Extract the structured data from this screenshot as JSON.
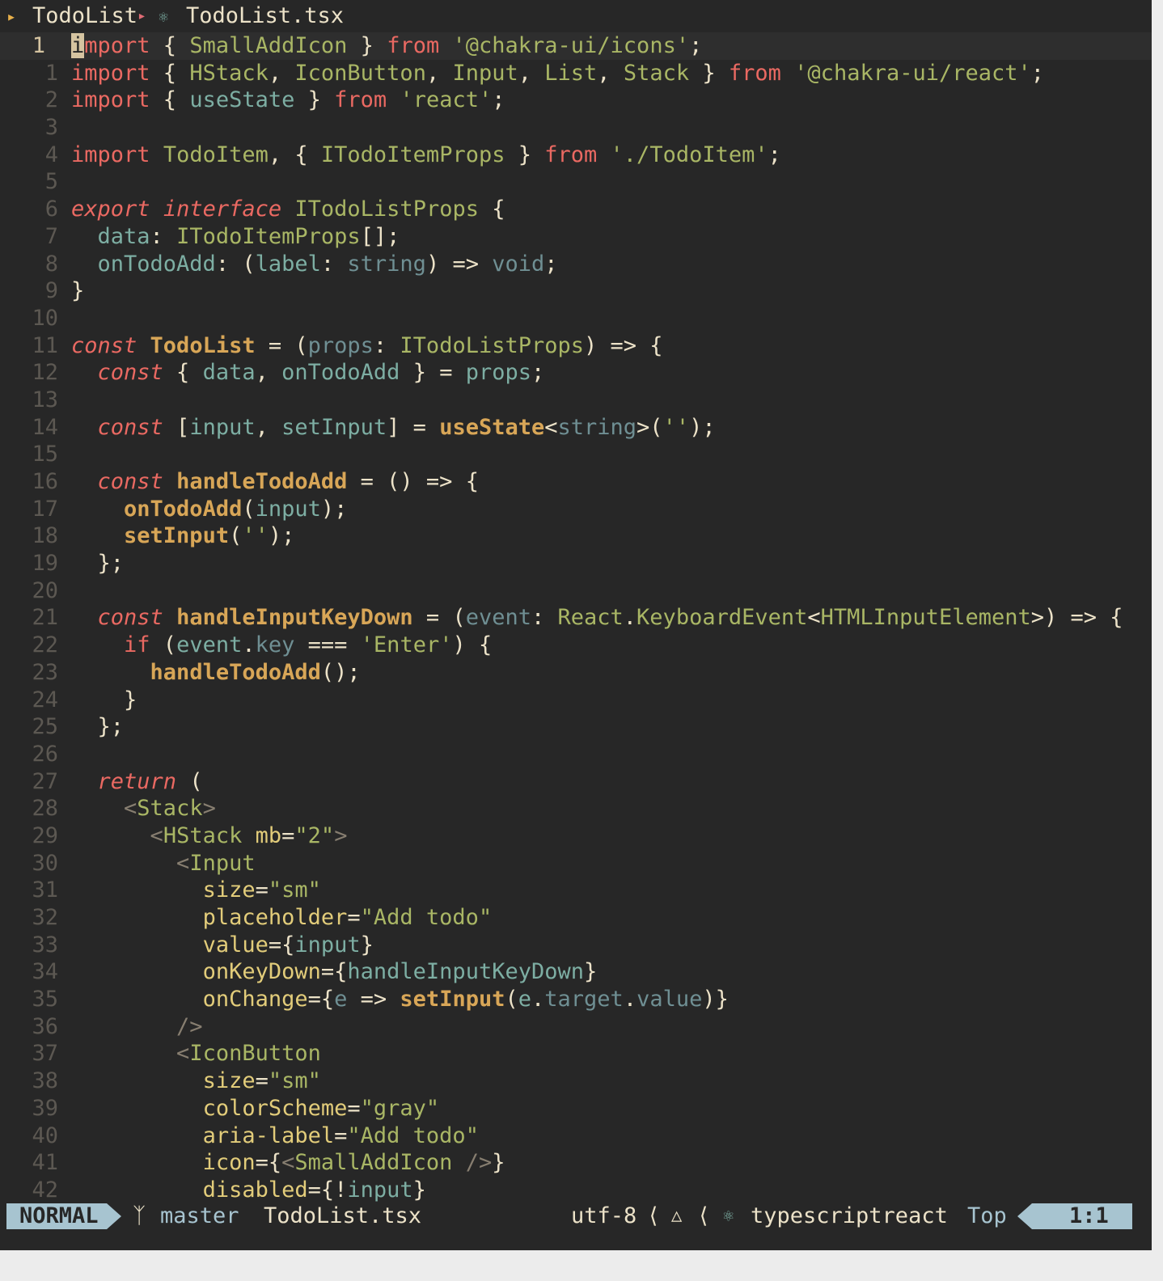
{
  "winbar": {
    "folder_name": "TodoList",
    "file_name": "TodoList.tsx",
    "icons": [
      "folder-icon",
      "chevron-right-icon",
      "react-icon"
    ]
  },
  "editor": {
    "cursor_line_number": "1",
    "lines": [
      {
        "n": "1",
        "current": true,
        "tokens": [
          [
            "cursor",
            "i"
          ],
          [
            "k",
            "mport"
          ],
          [
            "w",
            " { "
          ],
          [
            "t",
            "SmallAddIcon"
          ],
          [
            "w",
            " } "
          ],
          [
            "k",
            "from"
          ],
          [
            "w",
            " "
          ],
          [
            "s",
            "'@chakra-ui/icons'"
          ],
          [
            "w",
            ";"
          ]
        ]
      },
      {
        "n": "1",
        "tokens": [
          [
            "k",
            "import"
          ],
          [
            "w",
            " { "
          ],
          [
            "t",
            "HStack"
          ],
          [
            "w",
            ", "
          ],
          [
            "t",
            "IconButton"
          ],
          [
            "w",
            ", "
          ],
          [
            "t",
            "Input"
          ],
          [
            "w",
            ", "
          ],
          [
            "t",
            "List"
          ],
          [
            "w",
            ", "
          ],
          [
            "t",
            "Stack"
          ],
          [
            "w",
            " } "
          ],
          [
            "k",
            "from"
          ],
          [
            "w",
            " "
          ],
          [
            "s",
            "'@chakra-ui/react'"
          ],
          [
            "w",
            ";"
          ]
        ]
      },
      {
        "n": "2",
        "tokens": [
          [
            "k",
            "import"
          ],
          [
            "w",
            " { "
          ],
          [
            "p",
            "useState"
          ],
          [
            "w",
            " } "
          ],
          [
            "k",
            "from"
          ],
          [
            "w",
            " "
          ],
          [
            "s",
            "'react'"
          ],
          [
            "w",
            ";"
          ]
        ]
      },
      {
        "n": "3",
        "tokens": []
      },
      {
        "n": "4",
        "tokens": [
          [
            "k",
            "import"
          ],
          [
            "w",
            " "
          ],
          [
            "t",
            "TodoItem"
          ],
          [
            "w",
            ", { "
          ],
          [
            "t",
            "ITodoItemProps"
          ],
          [
            "w",
            " } "
          ],
          [
            "k",
            "from"
          ],
          [
            "w",
            " "
          ],
          [
            "s",
            "'./TodoItem'"
          ],
          [
            "w",
            ";"
          ]
        ]
      },
      {
        "n": "5",
        "tokens": []
      },
      {
        "n": "6",
        "tokens": [
          [
            "ki",
            "export"
          ],
          [
            "w",
            " "
          ],
          [
            "ki",
            "interface"
          ],
          [
            "w",
            " "
          ],
          [
            "t",
            "ITodoListProps"
          ],
          [
            "w",
            " {"
          ]
        ]
      },
      {
        "n": "7",
        "tokens": [
          [
            "w",
            "  "
          ],
          [
            "p",
            "data"
          ],
          [
            "w",
            ": "
          ],
          [
            "t",
            "ITodoItemProps"
          ],
          [
            "w",
            "[];"
          ]
        ]
      },
      {
        "n": "8",
        "tokens": [
          [
            "w",
            "  "
          ],
          [
            "p",
            "onTodoAdd"
          ],
          [
            "w",
            ": ("
          ],
          [
            "p",
            "label"
          ],
          [
            "w",
            ": "
          ],
          [
            "m",
            "string"
          ],
          [
            "w",
            ") => "
          ],
          [
            "m",
            "void"
          ],
          [
            "w",
            ";"
          ]
        ]
      },
      {
        "n": "9",
        "tokens": [
          [
            "w",
            "}"
          ]
        ]
      },
      {
        "n": "10",
        "tokens": []
      },
      {
        "n": "11",
        "tokens": [
          [
            "ki",
            "const"
          ],
          [
            "w",
            " "
          ],
          [
            "f",
            "TodoList"
          ],
          [
            "w",
            " = ("
          ],
          [
            "m",
            "props"
          ],
          [
            "w",
            ": "
          ],
          [
            "t",
            "ITodoListProps"
          ],
          [
            "w",
            ") => {"
          ]
        ]
      },
      {
        "n": "12",
        "tokens": [
          [
            "w",
            "  "
          ],
          [
            "ki",
            "const"
          ],
          [
            "w",
            " { "
          ],
          [
            "p",
            "data"
          ],
          [
            "w",
            ", "
          ],
          [
            "p",
            "onTodoAdd"
          ],
          [
            "w",
            " } = "
          ],
          [
            "p",
            "props"
          ],
          [
            "w",
            ";"
          ]
        ]
      },
      {
        "n": "13",
        "tokens": []
      },
      {
        "n": "14",
        "tokens": [
          [
            "w",
            "  "
          ],
          [
            "ki",
            "const"
          ],
          [
            "w",
            " ["
          ],
          [
            "p",
            "input"
          ],
          [
            "w",
            ", "
          ],
          [
            "p",
            "setInput"
          ],
          [
            "w",
            "] = "
          ],
          [
            "f",
            "useState"
          ],
          [
            "w",
            "<"
          ],
          [
            "m",
            "string"
          ],
          [
            "w",
            ">("
          ],
          [
            "s",
            "''"
          ],
          [
            "w",
            ");"
          ]
        ]
      },
      {
        "n": "15",
        "tokens": []
      },
      {
        "n": "16",
        "tokens": [
          [
            "w",
            "  "
          ],
          [
            "ki",
            "const"
          ],
          [
            "w",
            " "
          ],
          [
            "f",
            "handleTodoAdd"
          ],
          [
            "w",
            " = () => {"
          ]
        ]
      },
      {
        "n": "17",
        "tokens": [
          [
            "w",
            "    "
          ],
          [
            "f",
            "onTodoAdd"
          ],
          [
            "w",
            "("
          ],
          [
            "p",
            "input"
          ],
          [
            "w",
            ");"
          ]
        ]
      },
      {
        "n": "18",
        "tokens": [
          [
            "w",
            "    "
          ],
          [
            "f",
            "setInput"
          ],
          [
            "w",
            "("
          ],
          [
            "s",
            "''"
          ],
          [
            "w",
            ");"
          ]
        ]
      },
      {
        "n": "19",
        "tokens": [
          [
            "w",
            "  };"
          ]
        ]
      },
      {
        "n": "20",
        "tokens": []
      },
      {
        "n": "21",
        "tokens": [
          [
            "w",
            "  "
          ],
          [
            "ki",
            "const"
          ],
          [
            "w",
            " "
          ],
          [
            "f",
            "handleInputKeyDown"
          ],
          [
            "w",
            " = ("
          ],
          [
            "m",
            "event"
          ],
          [
            "w",
            ": "
          ],
          [
            "t",
            "React"
          ],
          [
            "w",
            "."
          ],
          [
            "t",
            "KeyboardEvent"
          ],
          [
            "w",
            "<"
          ],
          [
            "t",
            "HTMLInputElement"
          ],
          [
            "w",
            ">) => {"
          ]
        ]
      },
      {
        "n": "22",
        "tokens": [
          [
            "w",
            "    "
          ],
          [
            "k",
            "if"
          ],
          [
            "w",
            " ("
          ],
          [
            "p",
            "event"
          ],
          [
            "w",
            "."
          ],
          [
            "m",
            "key"
          ],
          [
            "w",
            " === "
          ],
          [
            "s",
            "'Enter'"
          ],
          [
            "w",
            ") {"
          ]
        ]
      },
      {
        "n": "23",
        "tokens": [
          [
            "w",
            "      "
          ],
          [
            "f",
            "handleTodoAdd"
          ],
          [
            "w",
            "();"
          ]
        ]
      },
      {
        "n": "24",
        "tokens": [
          [
            "w",
            "    }"
          ]
        ]
      },
      {
        "n": "25",
        "tokens": [
          [
            "w",
            "  };"
          ]
        ]
      },
      {
        "n": "26",
        "tokens": []
      },
      {
        "n": "27",
        "tokens": [
          [
            "w",
            "  "
          ],
          [
            "ki",
            "return"
          ],
          [
            "w",
            " ("
          ]
        ]
      },
      {
        "n": "28",
        "tokens": [
          [
            "w",
            "    "
          ],
          [
            "g",
            "<"
          ],
          [
            "tg",
            "Stack"
          ],
          [
            "g",
            ">"
          ]
        ]
      },
      {
        "n": "29",
        "tokens": [
          [
            "w",
            "      "
          ],
          [
            "g",
            "<"
          ],
          [
            "tg",
            "HStack"
          ],
          [
            "w",
            " "
          ],
          [
            "a",
            "mb"
          ],
          [
            "w",
            "="
          ],
          [
            "s",
            "\"2\""
          ],
          [
            "g",
            ">"
          ]
        ]
      },
      {
        "n": "30",
        "tokens": [
          [
            "w",
            "        "
          ],
          [
            "g",
            "<"
          ],
          [
            "tg",
            "Input"
          ]
        ]
      },
      {
        "n": "31",
        "tokens": [
          [
            "w",
            "          "
          ],
          [
            "a",
            "size"
          ],
          [
            "w",
            "="
          ],
          [
            "s",
            "\"sm\""
          ]
        ]
      },
      {
        "n": "32",
        "tokens": [
          [
            "w",
            "          "
          ],
          [
            "a",
            "placeholder"
          ],
          [
            "w",
            "="
          ],
          [
            "s",
            "\"Add todo\""
          ]
        ]
      },
      {
        "n": "33",
        "tokens": [
          [
            "w",
            "          "
          ],
          [
            "a",
            "value"
          ],
          [
            "w",
            "={"
          ],
          [
            "p",
            "input"
          ],
          [
            "w",
            "}"
          ]
        ]
      },
      {
        "n": "34",
        "tokens": [
          [
            "w",
            "          "
          ],
          [
            "a",
            "onKeyDown"
          ],
          [
            "w",
            "={"
          ],
          [
            "p",
            "handleInputKeyDown"
          ],
          [
            "w",
            "}"
          ]
        ]
      },
      {
        "n": "35",
        "tokens": [
          [
            "w",
            "          "
          ],
          [
            "a",
            "onChange"
          ],
          [
            "w",
            "={"
          ],
          [
            "m",
            "e"
          ],
          [
            "w",
            " => "
          ],
          [
            "f",
            "setInput"
          ],
          [
            "w",
            "("
          ],
          [
            "p",
            "e"
          ],
          [
            "w",
            "."
          ],
          [
            "m",
            "target"
          ],
          [
            "w",
            "."
          ],
          [
            "m",
            "value"
          ],
          [
            "w",
            ")}"
          ]
        ]
      },
      {
        "n": "36",
        "tokens": [
          [
            "w",
            "        "
          ],
          [
            "g",
            "/>"
          ]
        ]
      },
      {
        "n": "37",
        "tokens": [
          [
            "w",
            "        "
          ],
          [
            "g",
            "<"
          ],
          [
            "tg",
            "IconButton"
          ]
        ]
      },
      {
        "n": "38",
        "tokens": [
          [
            "w",
            "          "
          ],
          [
            "a",
            "size"
          ],
          [
            "w",
            "="
          ],
          [
            "s",
            "\"sm\""
          ]
        ]
      },
      {
        "n": "39",
        "tokens": [
          [
            "w",
            "          "
          ],
          [
            "a",
            "colorScheme"
          ],
          [
            "w",
            "="
          ],
          [
            "s",
            "\"gray\""
          ]
        ]
      },
      {
        "n": "40",
        "tokens": [
          [
            "w",
            "          "
          ],
          [
            "a",
            "aria-label"
          ],
          [
            "w",
            "="
          ],
          [
            "s",
            "\"Add todo\""
          ]
        ]
      },
      {
        "n": "41",
        "tokens": [
          [
            "w",
            "          "
          ],
          [
            "a",
            "icon"
          ],
          [
            "w",
            "={"
          ],
          [
            "g",
            "<"
          ],
          [
            "tg",
            "SmallAddIcon"
          ],
          [
            "w",
            " "
          ],
          [
            "g",
            "/>"
          ],
          [
            "w",
            "}"
          ]
        ]
      },
      {
        "n": "42",
        "tokens": [
          [
            "w",
            "          "
          ],
          [
            "a",
            "disabled"
          ],
          [
            "w",
            "={!"
          ],
          [
            "p",
            "input"
          ],
          [
            "w",
            "}"
          ]
        ]
      }
    ]
  },
  "statusline": {
    "mode": "NORMAL",
    "branch": "master",
    "file": "TodoList.tsx",
    "encoding": "utf-8",
    "filetype": "typescriptreact",
    "scroll": "Top",
    "position": "1:1",
    "icons": [
      "git-branch-icon",
      "linux-tux-icon",
      "react-icon"
    ]
  },
  "colors": {
    "background": "#272727",
    "keyword": "#ea6962",
    "string": "#a9b665",
    "function": "#d8a657",
    "property": "#7daea3",
    "mode_bg": "#a7c4d0"
  }
}
